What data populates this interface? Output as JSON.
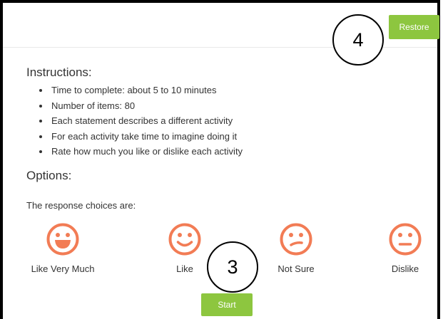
{
  "header": {
    "restore_label": "Restore"
  },
  "instructions": {
    "title": "Instructions:",
    "items": [
      "Time to complete: about 5 to 10 minutes",
      "Number of items: 80",
      "Each statement describes a different activity",
      "For each activity take time to imagine doing it",
      "Rate how much you like or dislike each activity"
    ]
  },
  "options": {
    "title": "Options:",
    "response_label": "The response choices are:",
    "choices": [
      {
        "label": "Like Very Much",
        "icon": "big-smile-icon"
      },
      {
        "label": "Like",
        "icon": "smile-icon"
      },
      {
        "label": "Not Sure",
        "icon": "unsure-face-icon"
      },
      {
        "label": "Dislike",
        "icon": "neutral-face-icon"
      }
    ]
  },
  "actions": {
    "start_label": "Start"
  },
  "annotations": {
    "marker_4": "4",
    "marker_3": "3"
  },
  "colors": {
    "accent": "#8dc63f",
    "face": "#f27c55"
  }
}
